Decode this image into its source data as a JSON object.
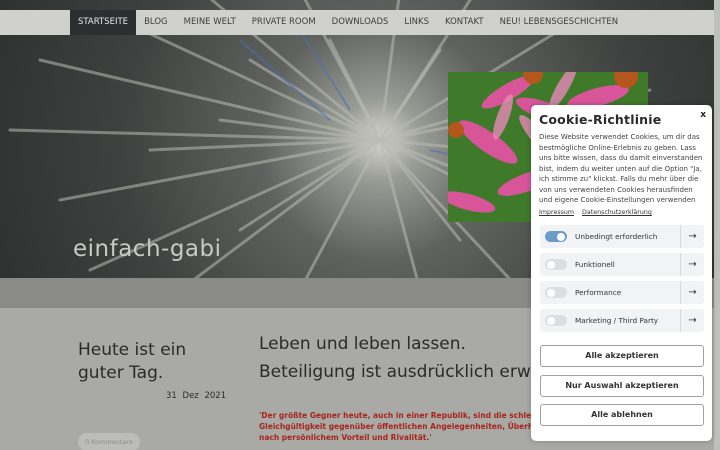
{
  "nav": {
    "items": [
      "STARTSEITE",
      "BLOG",
      "MEINE WELT",
      "PRIVATE ROOM",
      "DOWNLOADS",
      "LINKS",
      "KONTAKT",
      "NEU! LEBENSGESCHICHTEN"
    ]
  },
  "hero": {
    "site_title": "einfach-gabi"
  },
  "post": {
    "left_title": "Heute ist ein guter Tag.",
    "date_day": "31",
    "date_month": "Dez",
    "date_year": "2021",
    "comments": "0 Kommentare",
    "heading_line1": "Leben und leben lassen.",
    "heading_line2": "Beteiligung ist ausdrücklich erwünscht",
    "quote_line1": "'Der größte Gegner heute, auch in einer Republik, sind die schlechten Qualitäten:",
    "quote_line2": "Gleichgültigkeit gegenüber öffentlichen Angelegenheiten, Überheblichkeit, Egoismus",
    "quote_line3": "nach persönlichem Vorteil und Rivalität.'"
  },
  "cookie": {
    "close": "x",
    "title": "Cookie-Richtlinie",
    "description": "Diese Website verwendet Cookies, um dir das bestmögliche Online-Erlebnis zu geben. Lass uns bitte wissen, dass du damit einverstanden bist, indem du weiter unten auf die Option \"Ja, ich stimme zu\" klickst. Falls du mehr über die von uns verwendeten Cookies herausfinden und eigene Cookie-Einstellungen verwenden",
    "link_impressum": "Impressum",
    "link_privacy": "Datenschutzerklärung",
    "categories": [
      {
        "label": "Unbedingt erforderlich",
        "enabled": true
      },
      {
        "label": "Funktionell",
        "enabled": false
      },
      {
        "label": "Performance",
        "enabled": false
      },
      {
        "label": "Marketing / Third Party",
        "enabled": false
      }
    ],
    "btn_accept_all": "Alle akzeptieren",
    "btn_accept_selection": "Nur Auswahl akzeptieren",
    "btn_reject_all": "Alle ablehnen"
  }
}
